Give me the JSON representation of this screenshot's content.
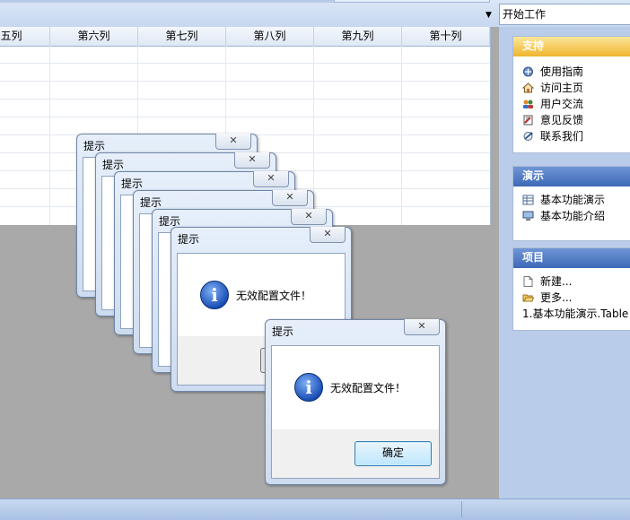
{
  "toolbar": {
    "start_label": "开始工作"
  },
  "grid": {
    "columns": [
      "第五列",
      "第六列",
      "第七列",
      "第八列",
      "第九列",
      "第十列"
    ]
  },
  "sidebar": {
    "support": {
      "title": "支持",
      "items": [
        {
          "label": "使用指南",
          "icon": "guide-icon"
        },
        {
          "label": "访问主页",
          "icon": "home-icon"
        },
        {
          "label": "用户交流",
          "icon": "users-icon"
        },
        {
          "label": "意见反馈",
          "icon": "feedback-icon"
        },
        {
          "label": "联系我们",
          "icon": "contact-icon"
        }
      ]
    },
    "demo": {
      "title": "演示",
      "items": [
        {
          "label": "基本功能演示",
          "icon": "table-icon"
        },
        {
          "label": "基本功能介绍",
          "icon": "monitor-icon"
        }
      ]
    },
    "project": {
      "title": "项目",
      "items": [
        {
          "label": "新建...",
          "icon": "new-file-icon"
        },
        {
          "label": "更多...",
          "icon": "open-folder-icon"
        }
      ],
      "recent": "1.基本功能演示.Table"
    }
  },
  "dialogs": {
    "title": "提示",
    "close_glyph": "✕",
    "message": "无效配置文件！",
    "ok_label": "确定",
    "info_glyph": "i"
  }
}
